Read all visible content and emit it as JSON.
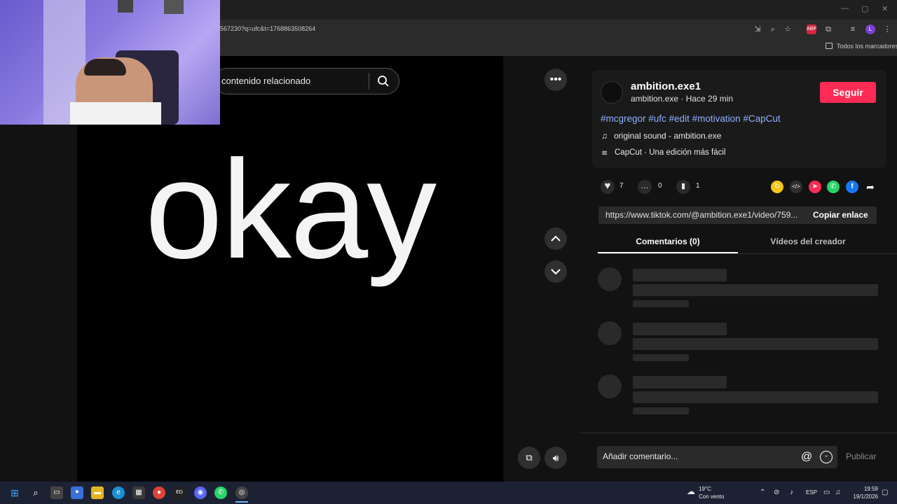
{
  "browser": {
    "url": "567230?q=ufc&t=1768863508264",
    "bookmarks_label": "Todos los marcadores"
  },
  "search": {
    "placeholder": "contenido relacionado"
  },
  "video": {
    "caption_text": "okay"
  },
  "post": {
    "username": "ambition.exe1",
    "subline": "ambition.exe · Hace 29 min",
    "follow_label": "Seguir",
    "hashtags": "#mcgregor #ufc #edit #motivation #CapCut",
    "sound": "original sound - ambition.exe",
    "capcut": "CapCut · Una edición más fácil",
    "likes": "7",
    "comments": "0",
    "saves": "1",
    "link": "https://www.tiktok.com/@ambition.exe1/video/759...",
    "copy_label": "Copiar enlace"
  },
  "tabs": {
    "comments": "Comentarios (0)",
    "creator_videos": "Vídeos del creador"
  },
  "comment_input": {
    "placeholder": "Añadir comentario...",
    "publish_label": "Publicar"
  },
  "taskbar": {
    "weather_temp": "19°C",
    "weather_desc": "Con vento",
    "lang": "ESP",
    "time": "19:59",
    "date": "19/1/2026"
  },
  "colors": {
    "accent": "#fe2c55",
    "hashtag": "#8fb0ff",
    "background": "#121212"
  },
  "icons": [
    "search-icon",
    "more-icon",
    "chevron-up-icon",
    "chevron-down-icon",
    "heart-icon",
    "comment-icon",
    "bookmark-icon",
    "music-note-icon",
    "capcut-icon",
    "embed-icon",
    "whatsapp-icon",
    "facebook-icon",
    "share-arrow-icon",
    "volume-icon",
    "mini-player-icon",
    "at-icon",
    "emoji-icon"
  ]
}
